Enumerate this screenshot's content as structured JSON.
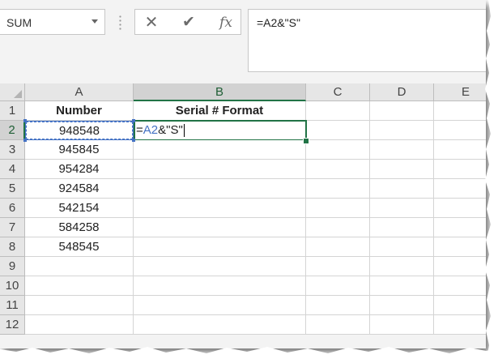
{
  "formula_bar": {
    "name_box": "SUM",
    "cancel_icon": "✕",
    "enter_icon": "✔",
    "insert_function_icon": "fx",
    "formula": "=A2&\"S\""
  },
  "columns": [
    "A",
    "B",
    "C",
    "D",
    "E"
  ],
  "rows": [
    "1",
    "2",
    "3",
    "4",
    "5",
    "6",
    "7",
    "8",
    "9",
    "10",
    "11",
    "12"
  ],
  "cells": {
    "A1": "Number",
    "B1": "Serial # Format",
    "A2": "948548",
    "A3": "945845",
    "A4": "954284",
    "A5": "924584",
    "A6": "542154",
    "A7": "584258",
    "A8": "548545"
  },
  "edit_cell": {
    "prefix": "=",
    "ref": "A2",
    "suffix": "&\"S\""
  },
  "colors": {
    "accent_green": "#217346",
    "ref_blue": "#4472c4"
  }
}
